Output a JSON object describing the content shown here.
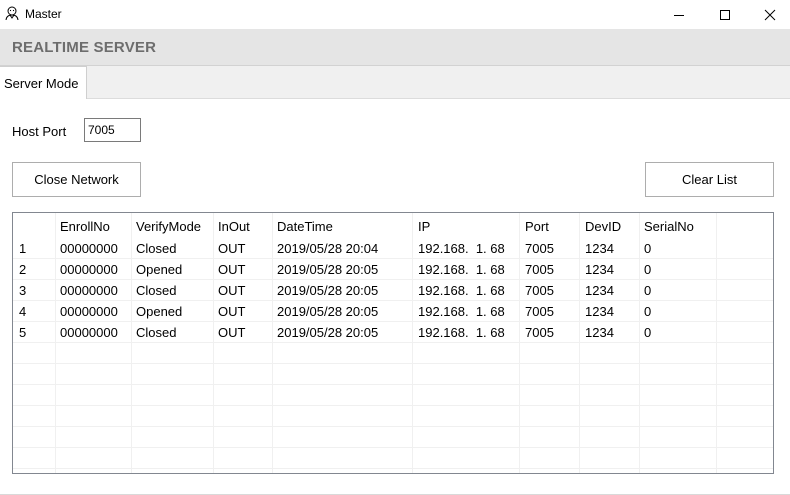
{
  "window": {
    "title": "Master",
    "icon": "person-outline-icon"
  },
  "header": {
    "title": "REALTIME SERVER"
  },
  "tabs": [
    {
      "label": "Server Mode",
      "active": true
    }
  ],
  "host": {
    "label": "Host Port",
    "value": "7005"
  },
  "buttons": {
    "close_network": "Close Network",
    "clear_list": "Clear List"
  },
  "table": {
    "columns": [
      "",
      "EnrollNo",
      "VerifyMode",
      "InOut",
      "DateTime",
      "IP",
      "Port",
      "DevID",
      "SerialNo"
    ],
    "rows": [
      [
        "1",
        "00000000",
        "Closed",
        "OUT",
        "2019/05/28 20:04",
        "192.168.  1. 68",
        "7005",
        "1234",
        "0"
      ],
      [
        "2",
        "00000000",
        "Opened",
        "OUT",
        "2019/05/28 20:05",
        "192.168.  1. 68",
        "7005",
        "1234",
        "0"
      ],
      [
        "3",
        "00000000",
        "Closed",
        "OUT",
        "2019/05/28 20:05",
        "192.168.  1. 68",
        "7005",
        "1234",
        "0"
      ],
      [
        "4",
        "00000000",
        "Opened",
        "OUT",
        "2019/05/28 20:05",
        "192.168.  1. 68",
        "7005",
        "1234",
        "0"
      ],
      [
        "5",
        "00000000",
        "Closed",
        "OUT",
        "2019/05/28 20:05",
        "192.168.  1. 68",
        "7005",
        "1234",
        "0"
      ]
    ]
  },
  "colors": {
    "header_bg": "#e5e5e5",
    "header_text": "#6d6d6d",
    "tab_strip_bg": "#f0f0f0",
    "grid_line": "#f0f0f0",
    "list_border": "#828790"
  }
}
